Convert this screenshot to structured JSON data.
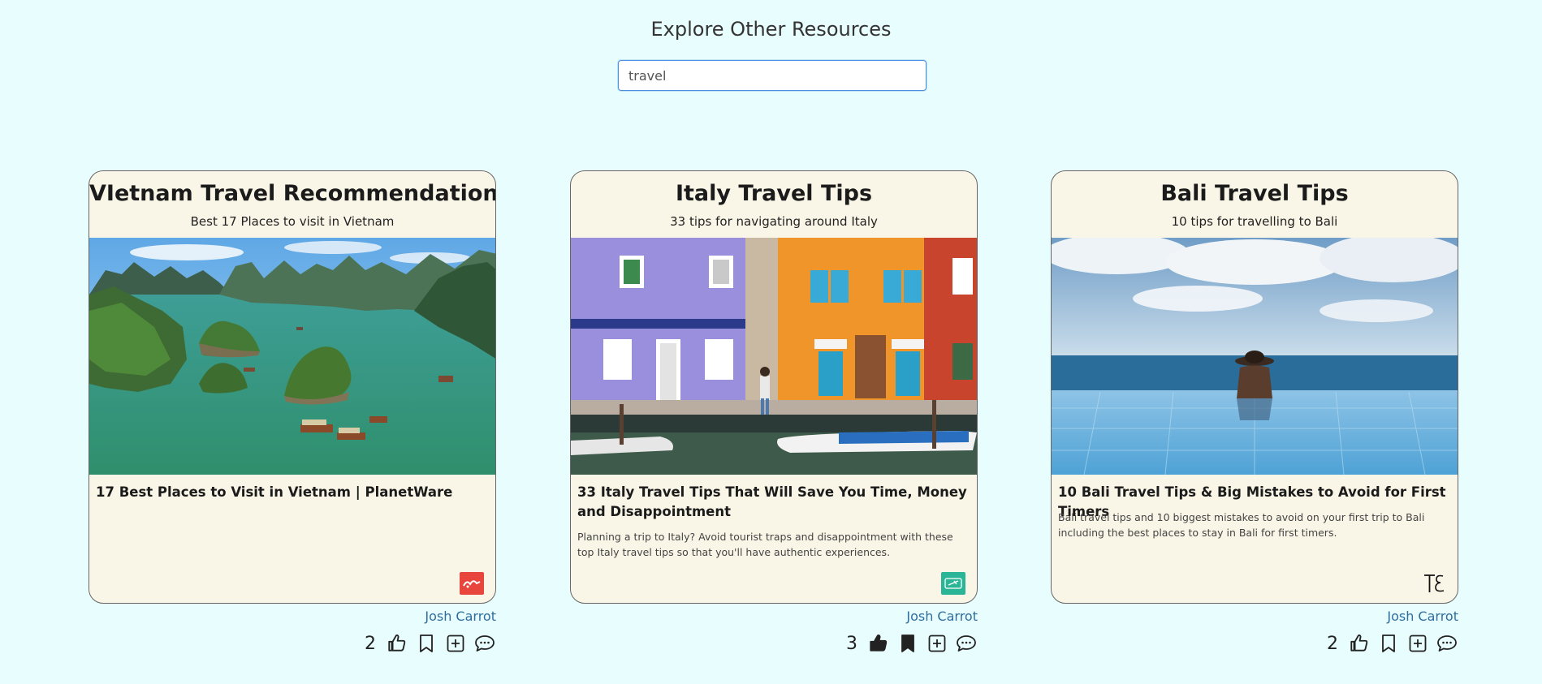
{
  "page": {
    "title": "Explore Other Resources"
  },
  "search": {
    "value": "travel"
  },
  "cards": [
    {
      "title": "VIetnam Travel Recommendations",
      "subtitle": "Best 17 Places to visit in Vietnam",
      "link_title": "17 Best Places to Visit in Vietnam | PlanetWare",
      "link_description": "",
      "favicon_color": "#e8453c",
      "favicon_icon": "planetware-logo-icon",
      "author": "Josh Carrot",
      "likes": "2",
      "liked": false,
      "bookmarked": false
    },
    {
      "title": "Italy Travel Tips",
      "subtitle": "33 tips for navigating around Italy",
      "link_title": "33 Italy Travel Tips That Will Save You Time, Money and Disappointment",
      "link_description": "Planning a trip to Italy? Avoid tourist traps and disappointment with these top Italy travel tips so that you'll have authentic experiences.",
      "favicon_color": "#2bb597",
      "favicon_icon": "airplane-ticket-icon",
      "author": "Josh Carrot",
      "likes": "3",
      "liked": true,
      "bookmarked": true
    },
    {
      "title": "Bali Travel Tips",
      "subtitle": "10 tips for travelling to Bali",
      "link_title": "10 Bali Travel Tips & Big Mistakes to Avoid for First Timers",
      "link_description": "Bali travel tips and 10 biggest mistakes to avoid on your first trip to Bali including the best places to stay in Bali for first timers.",
      "favicon_color": "#faf6e7",
      "favicon_icon": "te-monogram-icon",
      "author": "Josh Carrot",
      "likes": "2",
      "liked": false,
      "bookmarked": false
    }
  ]
}
